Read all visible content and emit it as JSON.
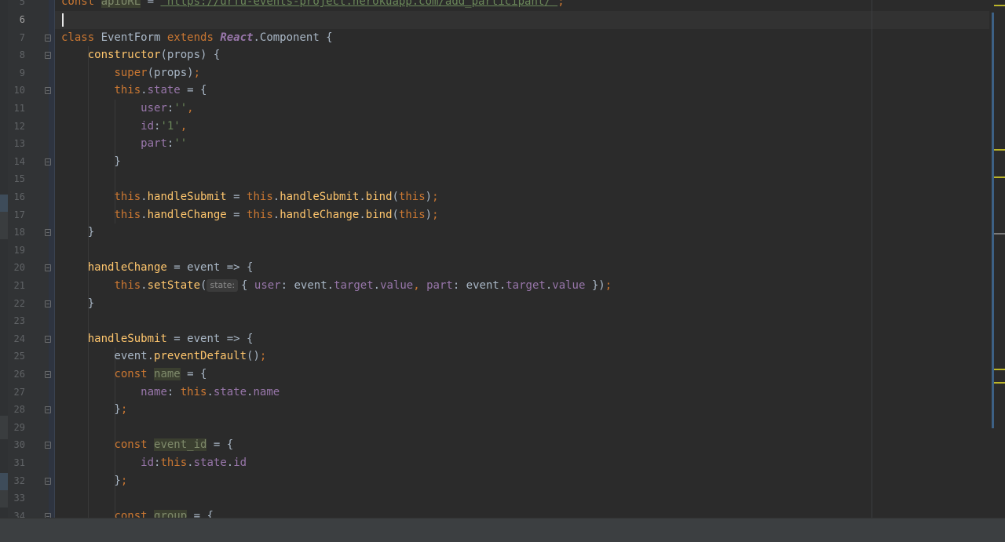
{
  "editor": {
    "lines": [
      {
        "num": "5",
        "html": "<span class=\"kw\">const </span><span class=\"hl\">apiURL</span> = <span class=\"url\">`https://urfu-events-project.herokuapp.com/add_participant/`</span><span class=\"kw\">;</span>"
      },
      {
        "num": "6",
        "html": ""
      },
      {
        "num": "7",
        "html": "<span class=\"kw\">class </span><span class=\"cls\">EventForm </span><span class=\"kw\">extends </span><span class=\"react\">React</span>.Component {"
      },
      {
        "num": "8",
        "html": "    <span class=\"fn\">constructor</span>(props) {"
      },
      {
        "num": "9",
        "html": "        <span class=\"kw\">super</span>(props)<span class=\"kw\">;</span>"
      },
      {
        "num": "10",
        "html": "        <span class=\"kw\">this</span>.<span class=\"prop\">state</span> = {"
      },
      {
        "num": "11",
        "html": "            <span class=\"prop\">user</span>:<span class=\"str\">''</span><span class=\"kw\">,</span>"
      },
      {
        "num": "12",
        "html": "            <span class=\"prop\">id</span>:<span class=\"str\">'1'</span><span class=\"kw\">,</span>"
      },
      {
        "num": "13",
        "html": "            <span class=\"prop\">part</span>:<span class=\"str\">''</span>"
      },
      {
        "num": "14",
        "html": "        }"
      },
      {
        "num": "15",
        "html": ""
      },
      {
        "num": "16",
        "html": "        <span class=\"kw\">this</span>.<span class=\"fn\">handleSubmit</span> = <span class=\"kw\">this</span>.<span class=\"fn\">handleSubmit</span>.<span class=\"fn\">bind</span>(<span class=\"kw\">this</span>)<span class=\"kw\">;</span>"
      },
      {
        "num": "17",
        "html": "        <span class=\"kw\">this</span>.<span class=\"fn\">handleChange</span> = <span class=\"kw\">this</span>.<span class=\"fn\">handleChange</span>.<span class=\"fn\">bind</span>(<span class=\"kw\">this</span>)<span class=\"kw\">;</span>"
      },
      {
        "num": "18",
        "html": "    }"
      },
      {
        "num": "19",
        "html": ""
      },
      {
        "num": "20",
        "html": "    <span class=\"fn\">handleChange</span> = event => {"
      },
      {
        "num": "21",
        "html": "        <span class=\"kw\">this</span>.<span class=\"fn\">setState</span>(<span class=\"hint\">state:</span>{ <span class=\"prop\">user</span>: event.<span class=\"prop\">target</span>.<span class=\"prop\">value</span><span class=\"kw\">, </span><span class=\"prop\">part</span>: event.<span class=\"prop\">target</span>.<span class=\"prop\">value</span> })<span class=\"kw\">;</span>"
      },
      {
        "num": "22",
        "html": "    }"
      },
      {
        "num": "23",
        "html": ""
      },
      {
        "num": "24",
        "html": "    <span class=\"fn\">handleSubmit</span> = event => {"
      },
      {
        "num": "25",
        "html": "        event.<span class=\"fn\">preventDefault</span>()<span class=\"kw\">;</span>"
      },
      {
        "num": "26",
        "html": "        <span class=\"kw\">const </span><span class=\"hl\">name</span> = {"
      },
      {
        "num": "27",
        "html": "            <span class=\"prop\">name</span>: <span class=\"kw\">this</span>.<span class=\"prop\">state</span>.<span class=\"prop\">name</span>"
      },
      {
        "num": "28",
        "html": "        }<span class=\"kw\">;</span>"
      },
      {
        "num": "29",
        "html": ""
      },
      {
        "num": "30",
        "html": "        <span class=\"kw\">const </span><span class=\"hl\">event_id</span> = {"
      },
      {
        "num": "31",
        "html": "            <span class=\"prop\">id</span>:<span class=\"kw\">this</span>.<span class=\"prop\">state</span>.<span class=\"prop\">id</span>"
      },
      {
        "num": "32",
        "html": "        }<span class=\"kw\">;</span>"
      },
      {
        "num": "33",
        "html": ""
      },
      {
        "num": "34",
        "html": "        <span class=\"kw\">const </span><span class=\"hl\">group</span> = {"
      }
    ],
    "current_line": "6",
    "colors": {
      "background": "#2b2b2b",
      "gutter": "#313335",
      "keyword": "#cc7832",
      "function": "#ffc66d",
      "property": "#9876aa",
      "string": "#6a8759",
      "plain": "#a9b7c6"
    }
  },
  "scrollbar": {
    "markers": [
      {
        "color": "#bbb529"
      },
      {
        "color": "#bbb529"
      },
      {
        "color": "#bbb529"
      },
      {
        "color": "#7a7a7a"
      },
      {
        "color": "#bbb529"
      },
      {
        "color": "#bbb529"
      }
    ]
  }
}
